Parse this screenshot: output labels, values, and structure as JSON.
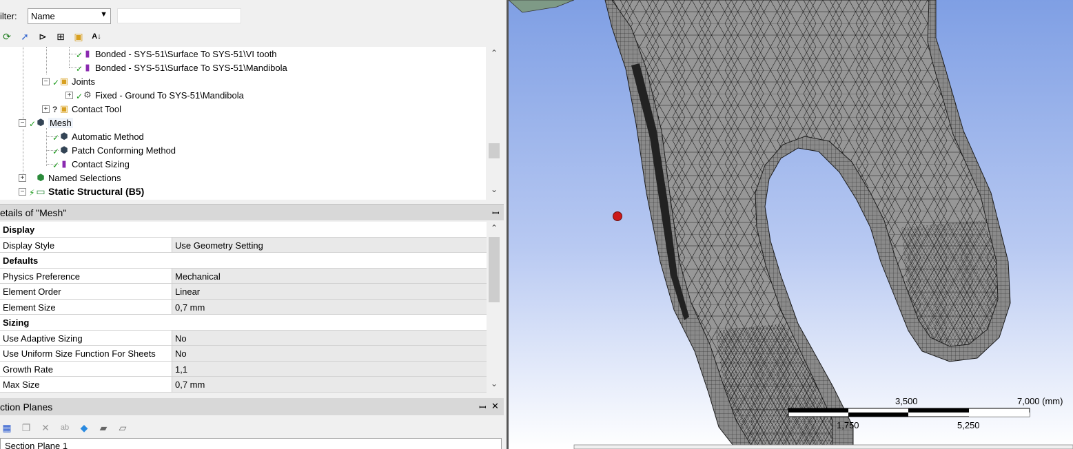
{
  "filter": {
    "label": "ilter:",
    "selected": "Name",
    "search_value": ""
  },
  "tree": {
    "items": [
      {
        "label": "Bonded - SYS-51\\Surface To SYS-51\\VI tooth"
      },
      {
        "label": "Bonded - SYS-51\\Surface To SYS-51\\Mandibola"
      },
      {
        "label": "Joints"
      },
      {
        "label": "Fixed - Ground To SYS-51\\Mandibola"
      },
      {
        "label": "Contact Tool"
      },
      {
        "label": "Mesh"
      },
      {
        "label": "Automatic Method"
      },
      {
        "label": "Patch Conforming Method"
      },
      {
        "label": "Contact Sizing"
      },
      {
        "label": "Named Selections"
      },
      {
        "label": "Static Structural (B5)"
      }
    ]
  },
  "details": {
    "title": "etails of \"Mesh\"",
    "rows": [
      {
        "type": "section",
        "name": "Display"
      },
      {
        "type": "prop",
        "name": "Display Style",
        "value": "Use Geometry Setting"
      },
      {
        "type": "section",
        "name": "Defaults"
      },
      {
        "type": "prop",
        "name": "Physics Preference",
        "value": "Mechanical"
      },
      {
        "type": "prop",
        "name": "Element Order",
        "value": "Linear"
      },
      {
        "type": "prop",
        "name": "Element Size",
        "value": "0,7 mm"
      },
      {
        "type": "section",
        "name": "Sizing"
      },
      {
        "type": "prop",
        "name": "Use Adaptive Sizing",
        "value": "No"
      },
      {
        "type": "prop",
        "name": "Use Uniform Size Function For Sheets",
        "value": "No"
      },
      {
        "type": "prop",
        "name": "Growth Rate",
        "value": "1,1"
      },
      {
        "type": "prop",
        "name": "Max Size",
        "value": "0,7 mm"
      }
    ]
  },
  "section_planes": {
    "title": "ction Planes",
    "pin": "ᵖ",
    "close": "✕",
    "items": [
      {
        "label": "Section Plane 1"
      }
    ]
  },
  "viewport": {
    "scale": {
      "top_labels": [
        "3,500",
        "7,000 (mm)"
      ],
      "bottom_labels": [
        "1,750",
        "5,250"
      ]
    },
    "colors": {
      "background_top": "#8aa6e6",
      "background_bottom": "#ffffff",
      "mesh_fill": "#8f8f8f",
      "mesh_lines": "#1c1c1c",
      "marker": "#cc1a1a"
    }
  }
}
